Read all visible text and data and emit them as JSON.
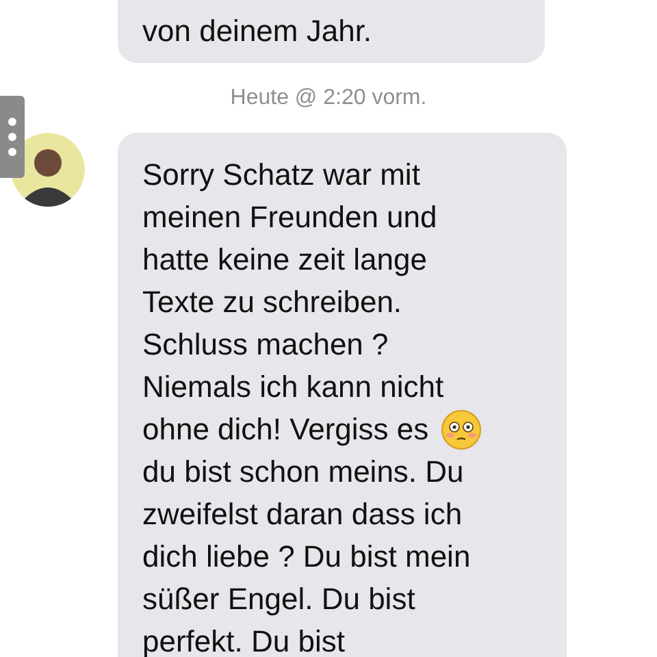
{
  "previous_message": {
    "text": "von deinem Jahr."
  },
  "timestamp": "Heute @ 2:20 vorm.",
  "message": {
    "lines": [
      {
        "text": "Sorry Schatz war mit",
        "emoji": false
      },
      {
        "text": "meinen Freunden und",
        "emoji": false
      },
      {
        "text": "hatte keine zeit lange",
        "emoji": false
      },
      {
        "text": "Texte zu schreiben.",
        "emoji": false
      },
      {
        "text": "Schluss machen ?",
        "emoji": false
      },
      {
        "text": "Niemals ich kann nicht",
        "emoji": false
      },
      {
        "text": "ohne dich! Vergiss es",
        "emoji": true
      },
      {
        "text": "du bist schon meins. Du",
        "emoji": false
      },
      {
        "text": "zweifelst daran dass ich",
        "emoji": false
      },
      {
        "text": "dich liebe ? Du bist mein",
        "emoji": false
      },
      {
        "text": "süßer Engel. Du bist",
        "emoji": false
      },
      {
        "text": "perfekt. Du bist",
        "emoji": false
      }
    ]
  }
}
